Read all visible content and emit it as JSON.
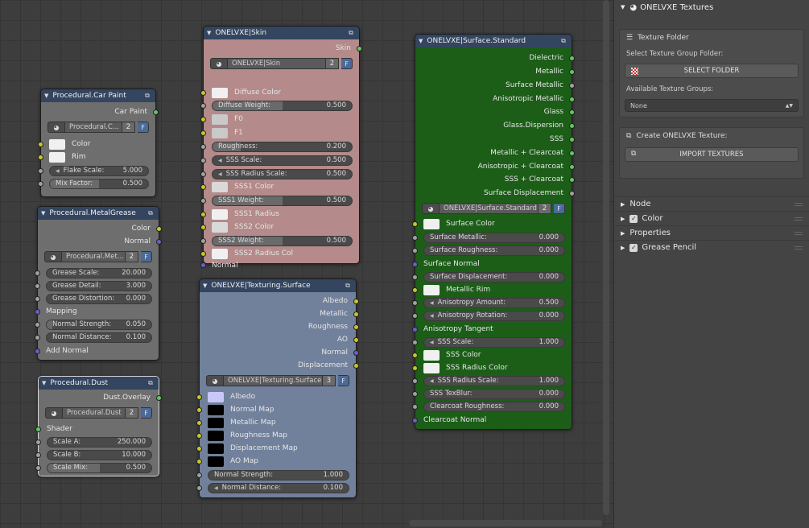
{
  "carpaint": {
    "title": "Procedural.Car Paint",
    "out": "Car Paint",
    "datablock": "Procedural.C...",
    "users": "2",
    "fake": "F",
    "in": [
      "Color",
      "Rim"
    ],
    "flake": {
      "label": "Flake Scale:",
      "value": "5.000"
    },
    "mix": {
      "label": "Mix Factor:",
      "value": "0.500"
    }
  },
  "metalgrease": {
    "title": "Procedural.MetalGrease",
    "outs": [
      "Color",
      "Normal"
    ],
    "datablock": "Procedural.Met...",
    "users": "2",
    "fake": "F",
    "f1": {
      "label": "Grease Scale:",
      "value": "20.000"
    },
    "f2": {
      "label": "Grease Detail:",
      "value": "3.000"
    },
    "f3": {
      "label": "Grease Distortion:",
      "value": "0.000"
    },
    "mapping": "Mapping",
    "f4": {
      "label": "Normal Strength:",
      "value": "0.050"
    },
    "f5": {
      "label": "Normal Distance:",
      "value": "0.100"
    },
    "addnormal": "Add Normal"
  },
  "dust": {
    "title": "Procedural.Dust",
    "out": "Dust.Overlay",
    "datablock": "Procedural.Dust",
    "users": "2",
    "fake": "F",
    "shader": "Shader",
    "f1": {
      "label": "Scale A:",
      "value": "250.000"
    },
    "f2": {
      "label": "Scale B:",
      "value": "10.000"
    },
    "f3": {
      "label": "Scale Mix:",
      "value": "0.500"
    }
  },
  "skin": {
    "title": "ONELVXE|Skin",
    "out": "Skin",
    "datablock": "ONELVXE|Skin",
    "users": "2",
    "fake": "F",
    "r1": "Diffuse Color",
    "r2": {
      "label": "Diffuse Weight:",
      "value": "0.500"
    },
    "r3": "F0",
    "r4": "F1",
    "r5": {
      "label": "Roughness:",
      "value": "0.200"
    },
    "r6": {
      "label": "SSS Scale:",
      "value": "0.500"
    },
    "r7": {
      "label": "SSS Radius Scale:",
      "value": "0.500"
    },
    "r8": "SSS1 Color",
    "r9": {
      "label": "SSS1 Weight:",
      "value": "0.500"
    },
    "r10": "SSS1 Radius",
    "r11": "SSS2 Color",
    "r12": {
      "label": "SSS2 Weight:",
      "value": "0.500"
    },
    "r13": "SSS2 Radius Col",
    "r14": "Normal"
  },
  "texturing": {
    "title": "ONELVXE|Texturing.Surface",
    "outs": [
      "Albedo",
      "Metallic",
      "Roughness",
      "AO",
      "Normal",
      "Displacement"
    ],
    "datablock": "ONELVXE|Texturing.Surface",
    "users": "3",
    "fake": "F",
    "ins": [
      "Albedo",
      "Normal Map",
      "Metallic Map",
      "Roughness Map",
      "Displacement Map",
      "AO Map"
    ],
    "f1": {
      "label": "Normal Strength:",
      "value": "1.000"
    },
    "f2": {
      "label": "Normal Distance:",
      "value": "0.100"
    }
  },
  "standard": {
    "title": "ONELVXE|Surface.Standard",
    "outs": [
      "Dielectric",
      "Metallic",
      "Surface Metallic",
      "Anisotropic Metallic",
      "Glass",
      "Glass.Dispersion",
      "SSS",
      "Metallic + Clearcoat",
      "Anisotropic + Clearcoat",
      "SSS + Clearcoat",
      "Surface Displacement"
    ],
    "datablock": "ONELVXE|Surface.Standard",
    "users": "2",
    "fake": "F",
    "surface_color": "Surface Color",
    "f1": {
      "label": "Surface Metallic:",
      "value": "0.000"
    },
    "f2": {
      "label": "Surface Roughness:",
      "value": "0.000"
    },
    "surface_normal": "Surface Normal",
    "f3": {
      "label": "Surface Displacement:",
      "value": "0.000"
    },
    "metallic_rim": "Metallic Rim",
    "f4": {
      "label": "Anisotropy Amount:",
      "value": "0.500"
    },
    "f5": {
      "label": "Anisotropy Rotation:",
      "value": "0.000"
    },
    "aniso_tangent": "Anisotropy Tangent",
    "f6": {
      "label": "SSS Scale:",
      "value": "1.000"
    },
    "sss_color": "SSS Color",
    "sss_radius_color": "SSS Radius Color",
    "f7": {
      "label": "SSS Radius Scale:",
      "value": "1.000"
    },
    "f8": {
      "label": "SSS TexBlur:",
      "value": "0.000"
    },
    "f9": {
      "label": "Clearcoat Roughness:",
      "value": "0.000"
    },
    "clearcoat_normal": "Clearcoat Normal"
  },
  "sidebar": {
    "header": "ONELVXE Textures",
    "tf_title": "Texture Folder",
    "tf_label": "Select Texture Group Folder:",
    "select_folder": "SELECT FOLDER",
    "groups_label": "Available Texture Groups:",
    "groups_value": "None",
    "create_label": "Create ONELVXE Texture:",
    "import": "IMPORT TEXTURES",
    "panels": [
      "Node",
      "Color",
      "Properties",
      "Grease Pencil"
    ]
  },
  "colors": {
    "socket_color": "#c7c729",
    "socket_shader": "#63c763",
    "socket_vector": "#6363c7",
    "socket_value": "#a1a1a1",
    "header": "#33455f",
    "skin_body": "#b48a8a",
    "texturing_body": "#71819c",
    "standard_body": "#1c5e18"
  }
}
